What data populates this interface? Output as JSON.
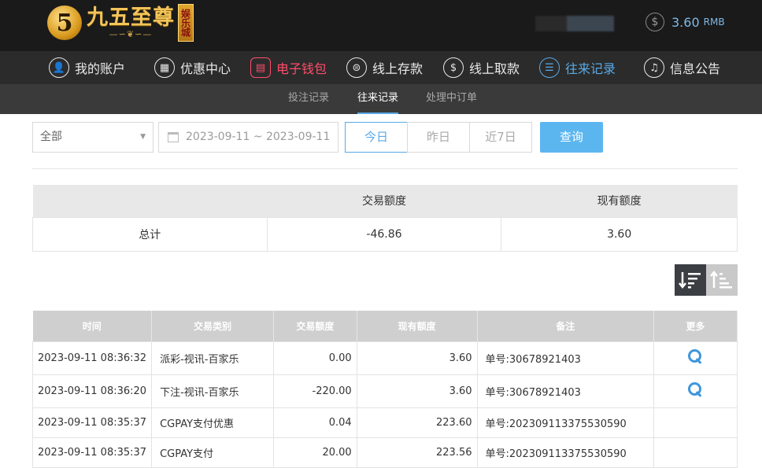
{
  "header": {
    "logo_digit": "5",
    "logo_text": "九五至尊",
    "logo_badge": "娱乐城",
    "balance_amount": "3.60",
    "balance_currency": "RMB"
  },
  "nav": [
    {
      "label": "我的账户",
      "icon": "user-icon"
    },
    {
      "label": "优惠中心",
      "icon": "gift-icon"
    },
    {
      "label": "电子钱包",
      "icon": "wallet-icon"
    },
    {
      "label": "线上存款",
      "icon": "deposit-icon"
    },
    {
      "label": "线上取款",
      "icon": "withdraw-icon"
    },
    {
      "label": "往来记录",
      "icon": "records-icon"
    },
    {
      "label": "信息公告",
      "icon": "bell-icon"
    }
  ],
  "subnav": [
    "投注记录",
    "往来记录",
    "处理中订单"
  ],
  "filters": {
    "type_value": "全部",
    "date_range": "2023-09-11 ~ 2023-09-11",
    "today": "今日",
    "yesterday": "昨日",
    "last7": "近7日",
    "query": "查询"
  },
  "summary": {
    "headers": [
      "",
      "交易额度",
      "现有额度"
    ],
    "row": [
      "总计",
      "-46.86",
      "3.60"
    ]
  },
  "detail": {
    "headers": [
      "时间",
      "交易类别",
      "交易额度",
      "现有额度",
      "备注",
      "更多"
    ],
    "rows": [
      {
        "time": "2023-09-11 08:36:32",
        "type": "派彩-视讯-百家乐",
        "amount": "0.00",
        "balance": "3.60",
        "note": "单号:30678921403",
        "more": true
      },
      {
        "time": "2023-09-11 08:36:20",
        "type": "下注-视讯-百家乐",
        "amount": "-220.00",
        "balance": "3.60",
        "note": "单号:30678921403",
        "more": true
      },
      {
        "time": "2023-09-11 08:35:37",
        "type": "CGPAY支付优惠",
        "amount": "0.04",
        "balance": "223.60",
        "note": "单号:202309113375530590",
        "more": false
      },
      {
        "time": "2023-09-11 08:35:37",
        "type": "CGPAY支付",
        "amount": "20.00",
        "balance": "223.56",
        "note": "单号:202309113375530590",
        "more": false
      }
    ]
  },
  "colors": {
    "accent_blue": "#5aa9e6",
    "active_red": "#ff4d6a",
    "query_button": "#5bb6f0"
  }
}
